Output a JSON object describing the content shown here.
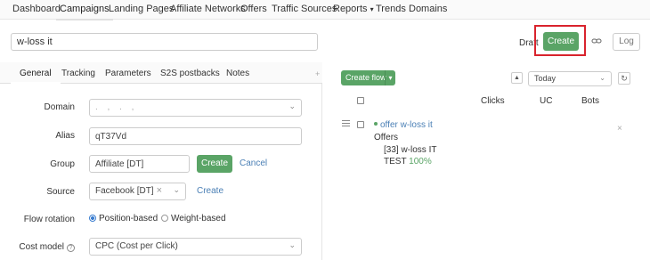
{
  "nav": {
    "items": [
      "Dashboard",
      "Campaigns",
      "Landing Pages",
      "Affiliate Networks",
      "Offers",
      "Traffic Sources",
      "Reports",
      "Trends",
      "Domains"
    ],
    "reports_caret": "▾"
  },
  "campaign": {
    "name": "w-loss it",
    "status": "Draft",
    "create_label": "Create",
    "link_icon": "link-icon",
    "log_label": "Log"
  },
  "tabs": [
    "General",
    "Tracking",
    "Parameters",
    "S2S postbacks",
    "Notes"
  ],
  "form": {
    "domain": {
      "label": "Domain",
      "value": ". , . ,"
    },
    "alias": {
      "label": "Alias",
      "value": "qT37Vd"
    },
    "group": {
      "label": "Group",
      "value": "Affiliate [DT]",
      "create_label": "Create",
      "cancel_label": "Cancel"
    },
    "source": {
      "label": "Source",
      "value": "Facebook [DT]",
      "create_label": "Create"
    },
    "flow_rotation": {
      "label": "Flow rotation",
      "options": [
        "Position-based",
        "Weight-based"
      ],
      "selected": "Position-based"
    },
    "cost_model": {
      "label": "Cost model",
      "value": "CPC (Cost per Click)"
    }
  },
  "flows": {
    "create_flow_label": "Create flow",
    "date_range": "Today",
    "columns": [
      "Clicks",
      "UC",
      "Bots"
    ],
    "items": [
      {
        "name": "offer w-loss it",
        "offers_label": "Offers",
        "offer": "[33] w-loss IT",
        "test_label": "TEST",
        "share": "100%"
      }
    ]
  },
  "colors": {
    "accent": "#5aa466",
    "link": "#4a7fb5",
    "highlight": "#d9232d"
  }
}
